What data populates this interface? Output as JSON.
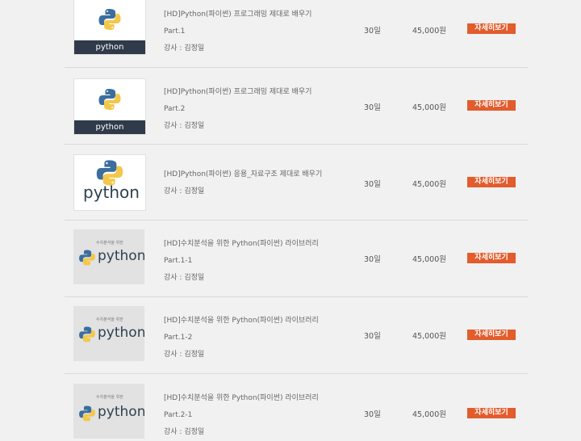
{
  "courses": [
    {
      "title": "[HD]Python(파이썬) 프로그래밍 제대로 배우기",
      "part": "Part.1",
      "instructor": "강사 : 김정일",
      "period": "30일",
      "price": "45,000원",
      "button": "자세히보기",
      "thumbnail": {
        "style": "dark-banner",
        "caption": "python",
        "icon": "python-logo-icon"
      }
    },
    {
      "title": "[HD]Python(파이썬) 프로그래밍 제대로 배우기",
      "part": "Part.2",
      "instructor": "강사 : 김정일",
      "period": "30일",
      "price": "45,000원",
      "button": "자세히보기",
      "thumbnail": {
        "style": "dark-banner",
        "caption": "python",
        "icon": "python-logo-icon"
      }
    },
    {
      "title": "[HD]Python(파이썬) 응용_자료구조 제대로 배우기",
      "part": "",
      "instructor": "강사 : 김정일",
      "period": "30일",
      "price": "45,000원",
      "button": "자세히보기",
      "thumbnail": {
        "style": "large-logo",
        "caption": "python",
        "icon": "python-logo-icon"
      }
    },
    {
      "title": "[HD]수치분석을 위한 Python(파이썬) 라이브러리",
      "part": "Part.1-1",
      "instructor": "강사 : 김정일",
      "period": "30일",
      "price": "45,000원",
      "button": "자세히보기",
      "thumbnail": {
        "style": "grey",
        "caption": "python",
        "note": "수치분석을 위한",
        "icon": "python-logo-icon"
      }
    },
    {
      "title": "[HD]수치분석을 위한 Python(파이썬) 라이브러리",
      "part": "Part.1-2",
      "instructor": "강사 : 김정일",
      "period": "30일",
      "price": "45,000원",
      "button": "자세히보기",
      "thumbnail": {
        "style": "grey",
        "caption": "python",
        "note": "수치분석을 위한",
        "icon": "python-logo-icon"
      }
    },
    {
      "title": "[HD]수치분석을 위한 Python(파이썬) 라이브러리",
      "part": "Part.2-1",
      "instructor": "강사 : 김정일",
      "period": "30일",
      "price": "45,000원",
      "button": "자세히보기",
      "thumbnail": {
        "style": "grey",
        "caption": "python",
        "note": "수치분석을 위한",
        "icon": "python-logo-icon"
      }
    }
  ],
  "colors": {
    "button": "#e25c2c",
    "python_blue": "#3b6e9e",
    "python_yellow": "#f3c84a",
    "banner": "#2f3a4a"
  }
}
